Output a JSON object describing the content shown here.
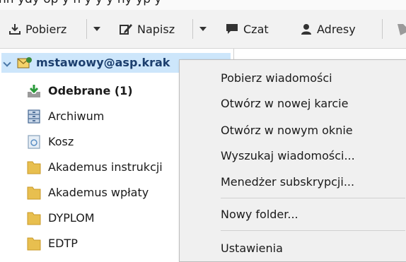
{
  "toolbar": {
    "get_mail": "Pobierz",
    "write": "Napisz",
    "chat": "Czat",
    "address_book": "Adresy"
  },
  "account": {
    "label": "mstawowy@asp.krak"
  },
  "folders": [
    {
      "name": "Odebrane (1)"
    },
    {
      "name": "Archiwum"
    },
    {
      "name": "Kosz"
    },
    {
      "name": "Akademus instrukcji"
    },
    {
      "name": "Akademus wpłaty"
    },
    {
      "name": "DYPLOM"
    },
    {
      "name": "EDTP"
    }
  ],
  "context_menu": {
    "items": [
      {
        "label": "Pobierz wiadomości"
      },
      {
        "label": "Otwórz w nowej karcie"
      },
      {
        "label": "Otwórz w nowym oknie"
      },
      {
        "label": "Wyszukaj wiadomości..."
      },
      {
        "label": "Menedżer subskrypcji..."
      },
      {
        "label": "Nowy folder..."
      },
      {
        "label": "Ustawienia"
      }
    ]
  },
  "icons": {
    "get_mail": "download-icon",
    "write": "pencil-icon",
    "chat": "chat-bubble-icon",
    "address_book": "person-icon",
    "inbox": "inbox-download-icon",
    "archive": "archive-box-icon",
    "trash": "trash-icon",
    "folder": "folder-icon"
  },
  "colors": {
    "selection": "#cde6fb",
    "folder": "#e8bf4f",
    "menu_bg": "#f0f0f0",
    "toolbar_bg": "#f2f2f2"
  }
}
